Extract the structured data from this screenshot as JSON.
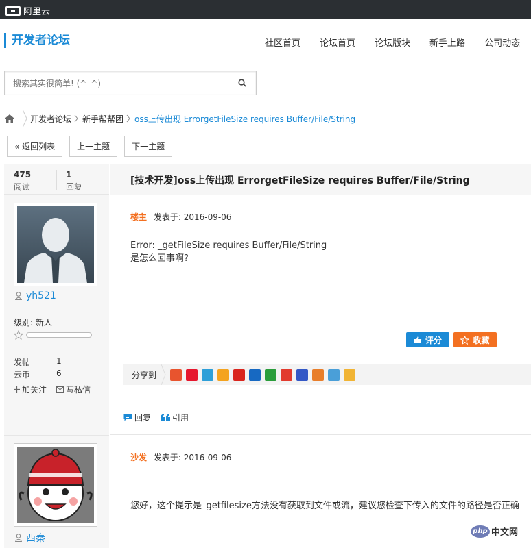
{
  "topbar": {
    "logo_text": "阿里云"
  },
  "header": {
    "brand": "开发者论坛",
    "nav": [
      "社区首页",
      "论坛首页",
      "论坛版块",
      "新手上路",
      "公司动态"
    ]
  },
  "search": {
    "placeholder": "搜索其实很简单! (^_^)"
  },
  "breadcrumb": {
    "items": [
      "开发者论坛",
      "新手帮帮团"
    ],
    "current": "oss上传出现 ErrorgetFileSize requires Buffer/File/String"
  },
  "buttons": {
    "back": "« 返回列表",
    "prev": "上一主题",
    "next": "下一主题"
  },
  "thread": {
    "views": "475",
    "views_label": "阅读",
    "replies": "1",
    "replies_label": "回复",
    "title": "[技术开发]oss上传出现 ErrorgetFileSize requires Buffer/File/String"
  },
  "posts": [
    {
      "author": "yh521",
      "level_label": "级别: 新人",
      "posts_label": "发帖",
      "posts_value": "1",
      "coins_label": "云币",
      "coins_value": "6",
      "follow": "加关注",
      "message": "写私信",
      "role": "楼主",
      "posted": "发表于: 2016-09-06",
      "content_lines": [
        "Error: _getFileSize requires Buffer/File/String",
        "是怎么回事啊?"
      ],
      "rate": "评分",
      "favorite": "收藏",
      "share_label": "分享到",
      "reply": "回复",
      "quote": "引用"
    },
    {
      "author": "西秦",
      "role": "沙发",
      "posted": "发表于: 2016-09-06",
      "content": "您好，这个提示是_getfilesize方法没有获取到文件或流，建议您检查下传入的文件的路径是否正确"
    }
  ],
  "share_icon_colors": [
    "#e8542e",
    "#e6162d",
    "#2d9fd8",
    "#f4a31f",
    "#d9251d",
    "#1769c2",
    "#2a9d3b",
    "#e23b2e",
    "#3458c6",
    "#e87e2a",
    "#4a9fd8",
    "#f1b434"
  ],
  "watermark": {
    "php": "php",
    "cn": "中文网"
  },
  "colors": {
    "accent": "#1b8ad6",
    "orange": "#f37021",
    "topbar": "#2b2f33"
  }
}
